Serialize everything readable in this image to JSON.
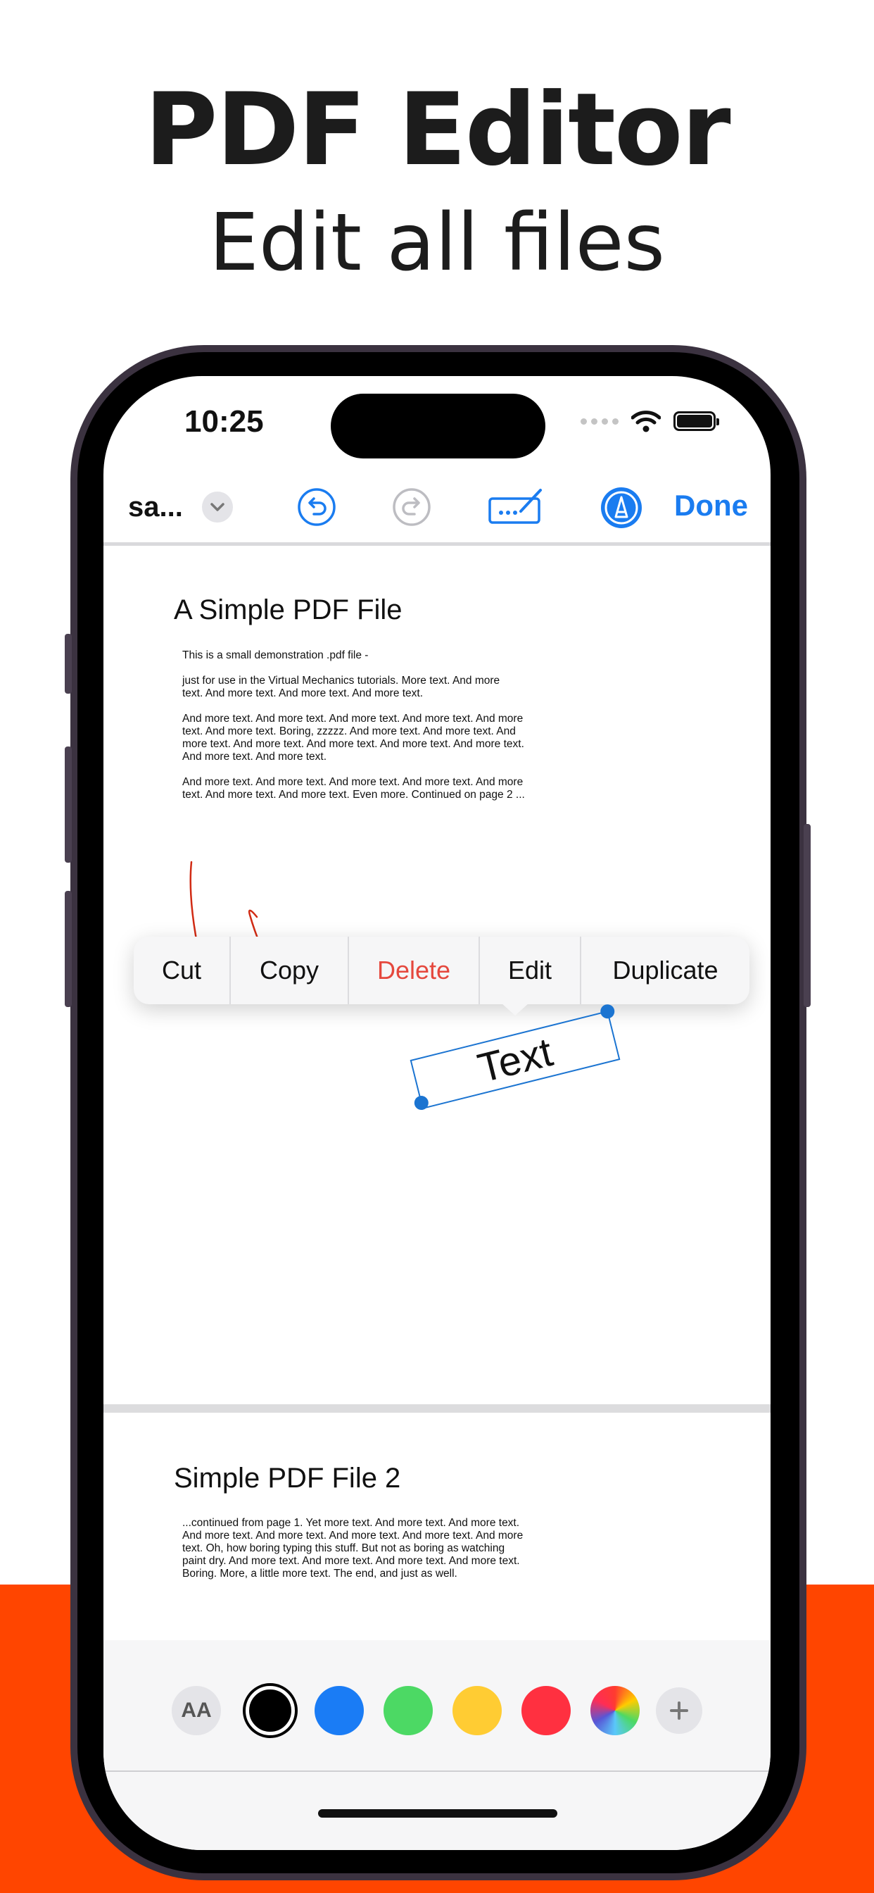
{
  "headline": {
    "title": "PDF Editor",
    "subtitle": "Edit all files"
  },
  "status_bar": {
    "time": "10:25"
  },
  "toolbar": {
    "doc_title": "sa...",
    "done_label": "Done"
  },
  "page1": {
    "title": "A Simple PDF File",
    "paragraphs": [
      "This is a small demonstration .pdf file -",
      "just for use in the Virtual Mechanics tutorials. More text. And more\ntext. And more text. And more text. And more text.",
      "And more text. And more text. And more text. And more text. And more\ntext. And more text. Boring, zzzzz. And more text. And more text. And\nmore text. And more text. And more text. And more text. And more text.\nAnd more text. And more text.",
      "And more text. And more text. And more text. And more text. And more\ntext. And more text. And more text. Even more. Continued on page 2 ..."
    ]
  },
  "context_menu": {
    "items": [
      "Cut",
      "Copy",
      "Delete",
      "Edit",
      "Duplicate"
    ]
  },
  "annotation": {
    "text": "Text"
  },
  "page2": {
    "title": "Simple PDF File 2",
    "paragraph": "...continued from page 1. Yet more text. And more text. And more text.\nAnd more text. And more text. And more text. And more text. And more\ntext. Oh, how boring typing this stuff. But not as boring as watching\npaint dry. And more text. And more text. And more text. And more text.\nBoring.  More, a little more text. The end, and just as well."
  },
  "palette": {
    "font_button": "AA",
    "colors": [
      "#000000",
      "#1a7cf5",
      "#4cd964",
      "#ffcc33",
      "#ff3040"
    ],
    "accent": "#1a7cf0",
    "ink_color": "#d12b14",
    "delete_color": "#e5483d",
    "background_accent": "#ff4500"
  }
}
